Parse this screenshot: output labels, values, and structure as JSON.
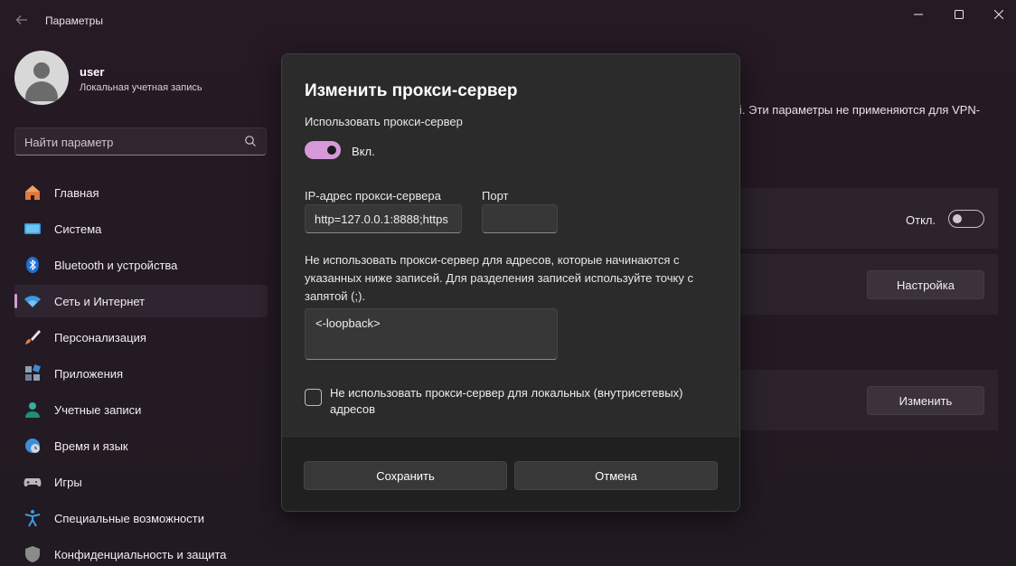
{
  "window": {
    "title": "Параметры"
  },
  "profile": {
    "name": "user",
    "account_type": "Локальная учетная запись"
  },
  "search": {
    "placeholder": "Найти параметр"
  },
  "sidebar": {
    "items": [
      {
        "label": "Главная",
        "icon": "home-icon"
      },
      {
        "label": "Система",
        "icon": "system-icon"
      },
      {
        "label": "Bluetooth и устройства",
        "icon": "bluetooth-icon"
      },
      {
        "label": "Сеть и Интернет",
        "icon": "wifi-icon",
        "active": true
      },
      {
        "label": "Персонализация",
        "icon": "brush-icon"
      },
      {
        "label": "Приложения",
        "icon": "apps-icon"
      },
      {
        "label": "Учетные записи",
        "icon": "accounts-icon"
      },
      {
        "label": "Время и язык",
        "icon": "time-language-icon"
      },
      {
        "label": "Игры",
        "icon": "gamepad-icon"
      },
      {
        "label": "Специальные возможности",
        "icon": "accessibility-icon"
      },
      {
        "label": "Конфиденциальность и защита",
        "icon": "shield-icon"
      }
    ]
  },
  "background": {
    "description_fragment": "i. Эти параметры не применяются для VPN-",
    "auto_detect_state": "Откл.",
    "setup_button": "Настройка",
    "edit_button": "Изменить"
  },
  "dialog": {
    "title": "Изменить прокси-сервер",
    "use_proxy_label": "Использовать прокси-сервер",
    "use_proxy_state": "Вкл.",
    "ip_label": "IP-адрес прокси-сервера",
    "ip_value": "http=127.0.0.1:8888;https",
    "port_label": "Порт",
    "port_value": "",
    "exclude_description": "Не использовать прокси-сервер для адресов, которые начинаются с указанных ниже записей. Для разделения записей используйте точку с запятой (;).",
    "exclude_value": "<-loopback>",
    "local_bypass_label": "Не использовать прокси-сервер для локальных (внутрисетевых) адресов",
    "local_bypass_checked": false,
    "save_button": "Сохранить",
    "cancel_button": "Отмена"
  },
  "colors": {
    "accent": "#d69ad8",
    "window_bg": "#251a24",
    "dialog_bg": "#2b2b2b"
  }
}
